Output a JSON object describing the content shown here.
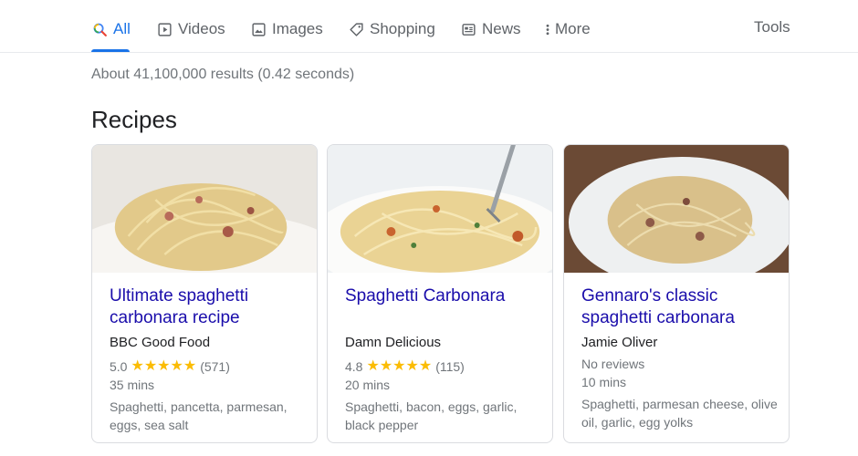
{
  "tabs": [
    {
      "label": "All",
      "icon": "search-icon",
      "active": true
    },
    {
      "label": "Videos",
      "icon": "video-icon"
    },
    {
      "label": "Images",
      "icon": "image-icon"
    },
    {
      "label": "Shopping",
      "icon": "tag-icon"
    },
    {
      "label": "News",
      "icon": "newspaper-icon"
    },
    {
      "label": "More",
      "icon": "more-vertical-icon"
    }
  ],
  "tools_label": "Tools",
  "result_stats": "About 41,100,000 results (0.42 seconds)",
  "section_heading": "Recipes",
  "colors": {
    "accent": "#1a73e8",
    "link": "#1a0dab",
    "star": "#fbbc04",
    "muted": "#70757a"
  },
  "recipes": [
    {
      "title": "Ultimate spaghetti carbonara recipe",
      "source": "BBC Good Food",
      "rating": "5.0",
      "stars": "★★★★★",
      "reviews": "(571)",
      "time": "35 mins",
      "ingredients": "Spaghetti, pancetta, parmesan, eggs, sea salt"
    },
    {
      "title": "Spaghetti Carbonara",
      "source": "Damn Delicious",
      "rating": "4.8",
      "stars": "★★★★★",
      "reviews": "(115)",
      "time": "20 mins",
      "ingredients": "Spaghetti, bacon, eggs, garlic, black pepper"
    },
    {
      "title": "Gennaro's classic spaghetti carbonara",
      "source": "Jamie Oliver",
      "no_reviews": "No reviews",
      "time": "10 mins",
      "ingredients": "Spaghetti, parmesan cheese, olive oil, garlic, egg yolks"
    }
  ]
}
